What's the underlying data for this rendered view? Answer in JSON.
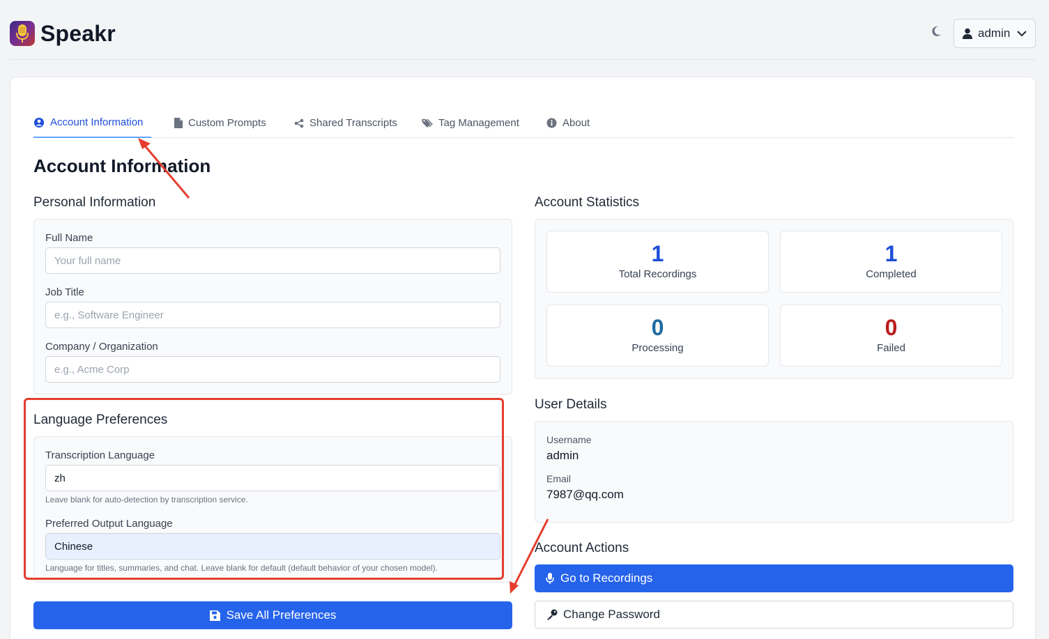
{
  "header": {
    "brand": "Speakr",
    "user_label": "admin"
  },
  "tabs": [
    {
      "label": "Account Information",
      "icon": "user-circle-icon",
      "active": true
    },
    {
      "label": "Custom Prompts",
      "icon": "file-icon",
      "active": false
    },
    {
      "label": "Shared Transcripts",
      "icon": "share-icon",
      "active": false
    },
    {
      "label": "Tag Management",
      "icon": "tags-icon",
      "active": false
    },
    {
      "label": "About",
      "icon": "info-icon",
      "active": false
    }
  ],
  "page_title": "Account Information",
  "personal": {
    "title": "Personal Information",
    "full_name": {
      "label": "Full Name",
      "placeholder": "Your full name",
      "value": ""
    },
    "job_title": {
      "label": "Job Title",
      "placeholder": "e.g., Software Engineer",
      "value": ""
    },
    "company": {
      "label": "Company / Organization",
      "placeholder": "e.g., Acme Corp",
      "value": ""
    }
  },
  "language": {
    "title": "Language Preferences",
    "transcription": {
      "label": "Transcription Language",
      "value": "zh",
      "help": "Leave blank for auto-detection by transcription service."
    },
    "output": {
      "label": "Preferred Output Language",
      "value": "Chinese",
      "help": "Language for titles, summaries, and chat. Leave blank for default (default behavior of your chosen model)."
    }
  },
  "save_button": "Save All Preferences",
  "stats": {
    "title": "Account Statistics",
    "items": [
      {
        "value": "1",
        "label": "Total Recordings",
        "color": "#1d4ed8"
      },
      {
        "value": "1",
        "label": "Completed",
        "color": "#1d4ed8"
      },
      {
        "value": "0",
        "label": "Processing",
        "color": "#1e6aa0"
      },
      {
        "value": "0",
        "label": "Failed",
        "color": "#b91c1c"
      }
    ]
  },
  "details": {
    "title": "User Details",
    "username_label": "Username",
    "username": "admin",
    "email_label": "Email",
    "email": "7987@qq.com"
  },
  "actions": {
    "title": "Account Actions",
    "go_recordings": "Go to Recordings",
    "change_password": "Change Password"
  },
  "colors": {
    "primary": "#2563eb",
    "annotation": "#e53e2f"
  }
}
